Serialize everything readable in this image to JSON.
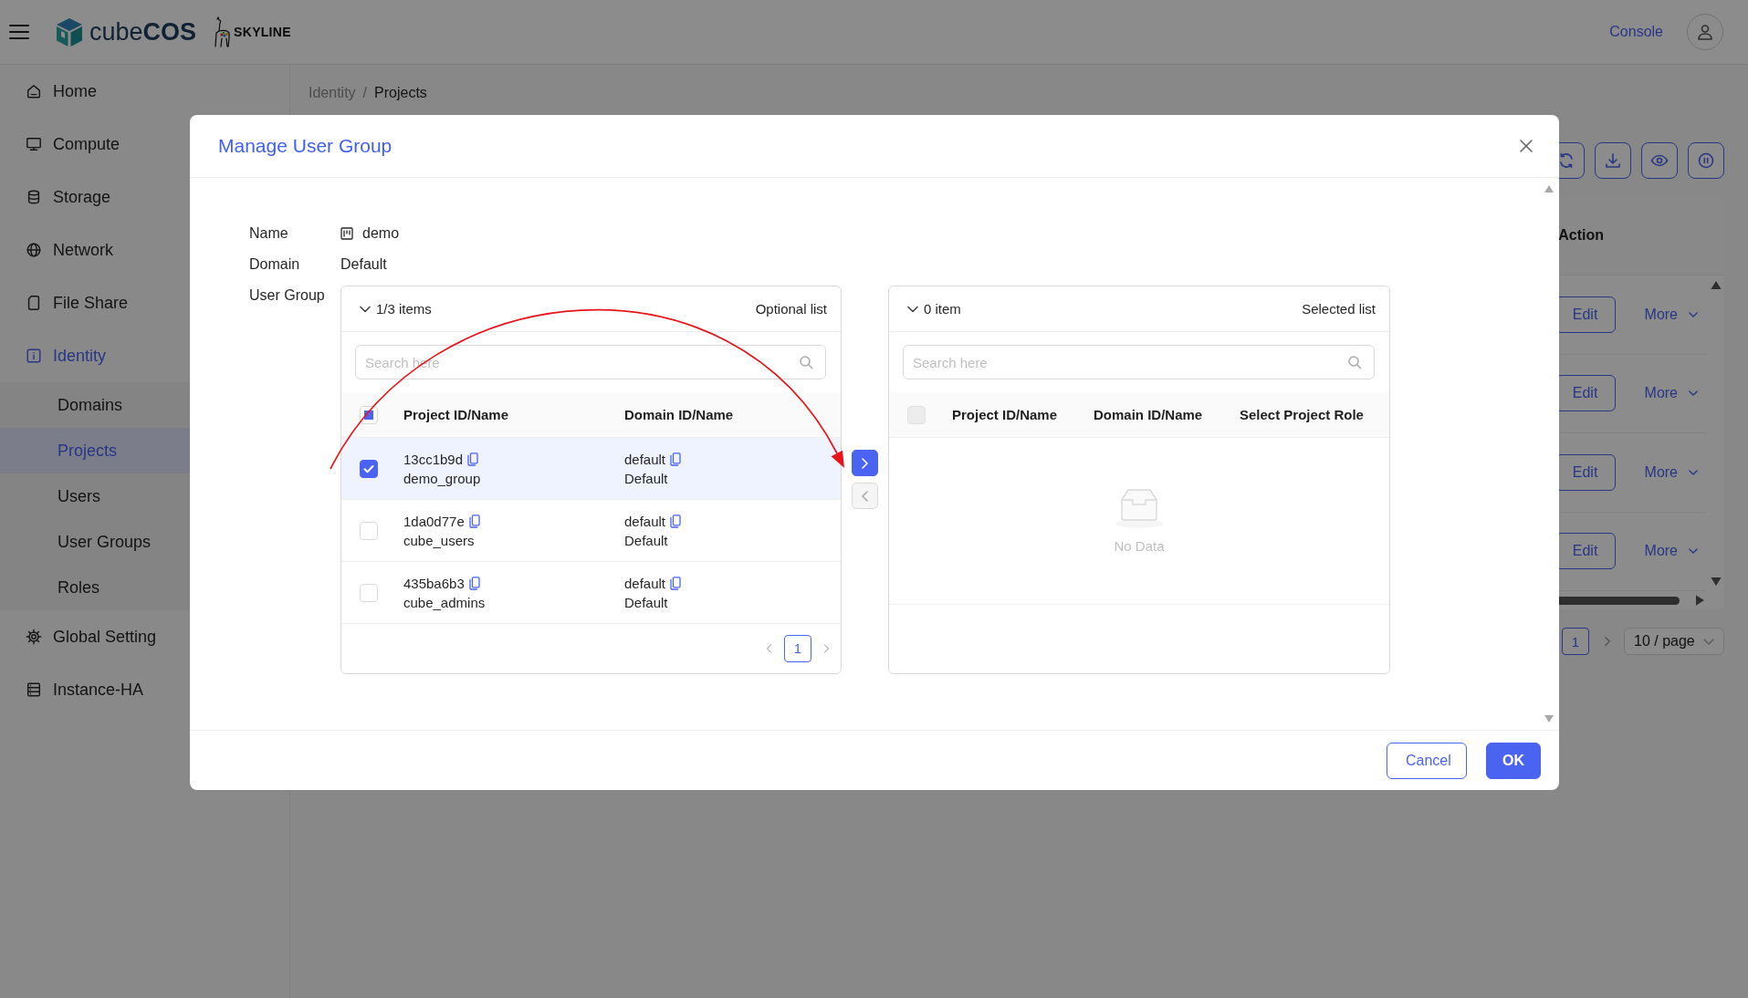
{
  "top_bar": {
    "brand": "cube**COS**",
    "logo_text": "SKYLINE",
    "console_link": "Console"
  },
  "sidebar": {
    "items": [
      {
        "label": "Home",
        "selected": false
      },
      {
        "label": "Compute",
        "selected": false
      },
      {
        "label": "Storage",
        "selected": false
      },
      {
        "label": "Network",
        "selected": false
      },
      {
        "label": "File Share",
        "selected": false
      },
      {
        "label": "Identity",
        "selected": true,
        "children": [
          {
            "label": "Domains",
            "selected": false
          },
          {
            "label": "Projects",
            "selected": true
          },
          {
            "label": "Users",
            "selected": false
          },
          {
            "label": "User Groups",
            "selected": false
          },
          {
            "label": "Roles",
            "selected": false
          }
        ]
      },
      {
        "label": "Global Setting",
        "selected": false
      },
      {
        "label": "Instance-HA",
        "selected": false
      }
    ]
  },
  "breadcrumb": {
    "separator": "/",
    "items": [
      {
        "label": "Identity",
        "current": false
      },
      {
        "label": "Projects",
        "current": true
      }
    ]
  },
  "table": {
    "columns": [
      "Action"
    ],
    "rows": [
      {
        "edit": "Edit",
        "more": "More"
      },
      {
        "edit": "Edit",
        "more": "More"
      },
      {
        "edit": "Edit",
        "more": "More"
      },
      {
        "edit": "Edit",
        "more": "More"
      }
    ]
  },
  "pagination": {
    "pages": [
      {
        "label": "1",
        "selected": true
      }
    ],
    "page_size": "10 / page"
  },
  "dialog": {
    "title": "Manage User Group",
    "fields": [
      {
        "label": "Name",
        "value": "demo",
        "kind": "name"
      },
      {
        "label": "Domain",
        "value": "Default",
        "kind": "text"
      }
    ],
    "user_group": {
      "label": "User Group",
      "source": {
        "count": "1/3 items",
        "title": "Optional list",
        "search": {
          "placeholder": "Search here"
        },
        "select_all": {
          "indeterminate": true
        },
        "columns": [
          "Project ID/Name",
          "Domain ID/Name"
        ],
        "rows": [
          {
            "project_id": "13cc1b9d",
            "project_name": "demo_group",
            "domain_id": "default",
            "domain_name": "Default",
            "checked": true
          },
          {
            "project_id": "1da0d77e",
            "project_name": "cube_users",
            "domain_id": "default",
            "domain_name": "Default",
            "checked": false
          },
          {
            "project_id": "435ba6b3",
            "project_name": "cube_admins",
            "domain_id": "default",
            "domain_name": "Default",
            "checked": false
          }
        ],
        "pagination": {
          "pages": [
            {
              "label": "1",
              "selected": true
            }
          ]
        }
      },
      "transfer_buttons": [
        {
          "kind": "right",
          "disabled": false
        },
        {
          "kind": "left",
          "disabled": true
        }
      ],
      "target": {
        "count": "0 item",
        "title": "Selected list",
        "search": {
          "placeholder": "Search here"
        },
        "select_all": {
          "indeterminate": false,
          "disabled": true
        },
        "columns": [
          "Project ID/Name",
          "Domain ID/Name",
          "Select Project Role"
        ],
        "empty_text": "No Data"
      }
    },
    "buttons": [
      {
        "label": "Cancel",
        "kind": "secondary"
      },
      {
        "label": "OK",
        "kind": "primary"
      }
    ]
  }
}
